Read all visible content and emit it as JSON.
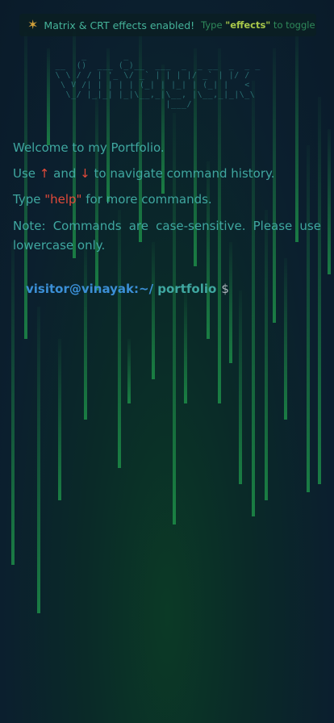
{
  "banner": {
    "icon": "sparkle-icon",
    "message": "Matrix & CRT effects enabled!",
    "hint_prefix": "Type ",
    "hint_keyword": "\"effects\"",
    "hint_suffix": " to toggle"
  },
  "ascii_logo": "      _       _\n __  ()  ___ (_)__  ___  _  _ __  _  _ _\n \\ \\ / / | '_ \\/ _` | | | |/ _` | |/ /\n  \\ V /| | | | | (_| | |_| | (_| |   <\n   \\_/ |_|_| |_|\\__,_|\\__, |\\__,_|_|\\_\\\n                      |___/",
  "welcome": {
    "line1": "Welcome to my Portfolio.",
    "use_prefix": "Use ",
    "up_arrow": "↑",
    "and": " and ",
    "down_arrow": "↓",
    "use_suffix": " to navigate command history.",
    "type_prefix": "Type ",
    "help_cmd": "\"help\"",
    "type_suffix": " for more commands.",
    "note_words": [
      "Note:",
      "Commands",
      "are",
      "case-sensitive.",
      "Please",
      "use"
    ],
    "note_line2": "lowercase only."
  },
  "prompt": {
    "user": "visitor@vinayak:~/",
    "path": " portfolio",
    "dollar": "$"
  },
  "colors": {
    "rain": "#1f9a4c",
    "accent_red": "#e24a3a",
    "prompt_user": "#3b8fd6",
    "text": "#3fa7a0"
  }
}
